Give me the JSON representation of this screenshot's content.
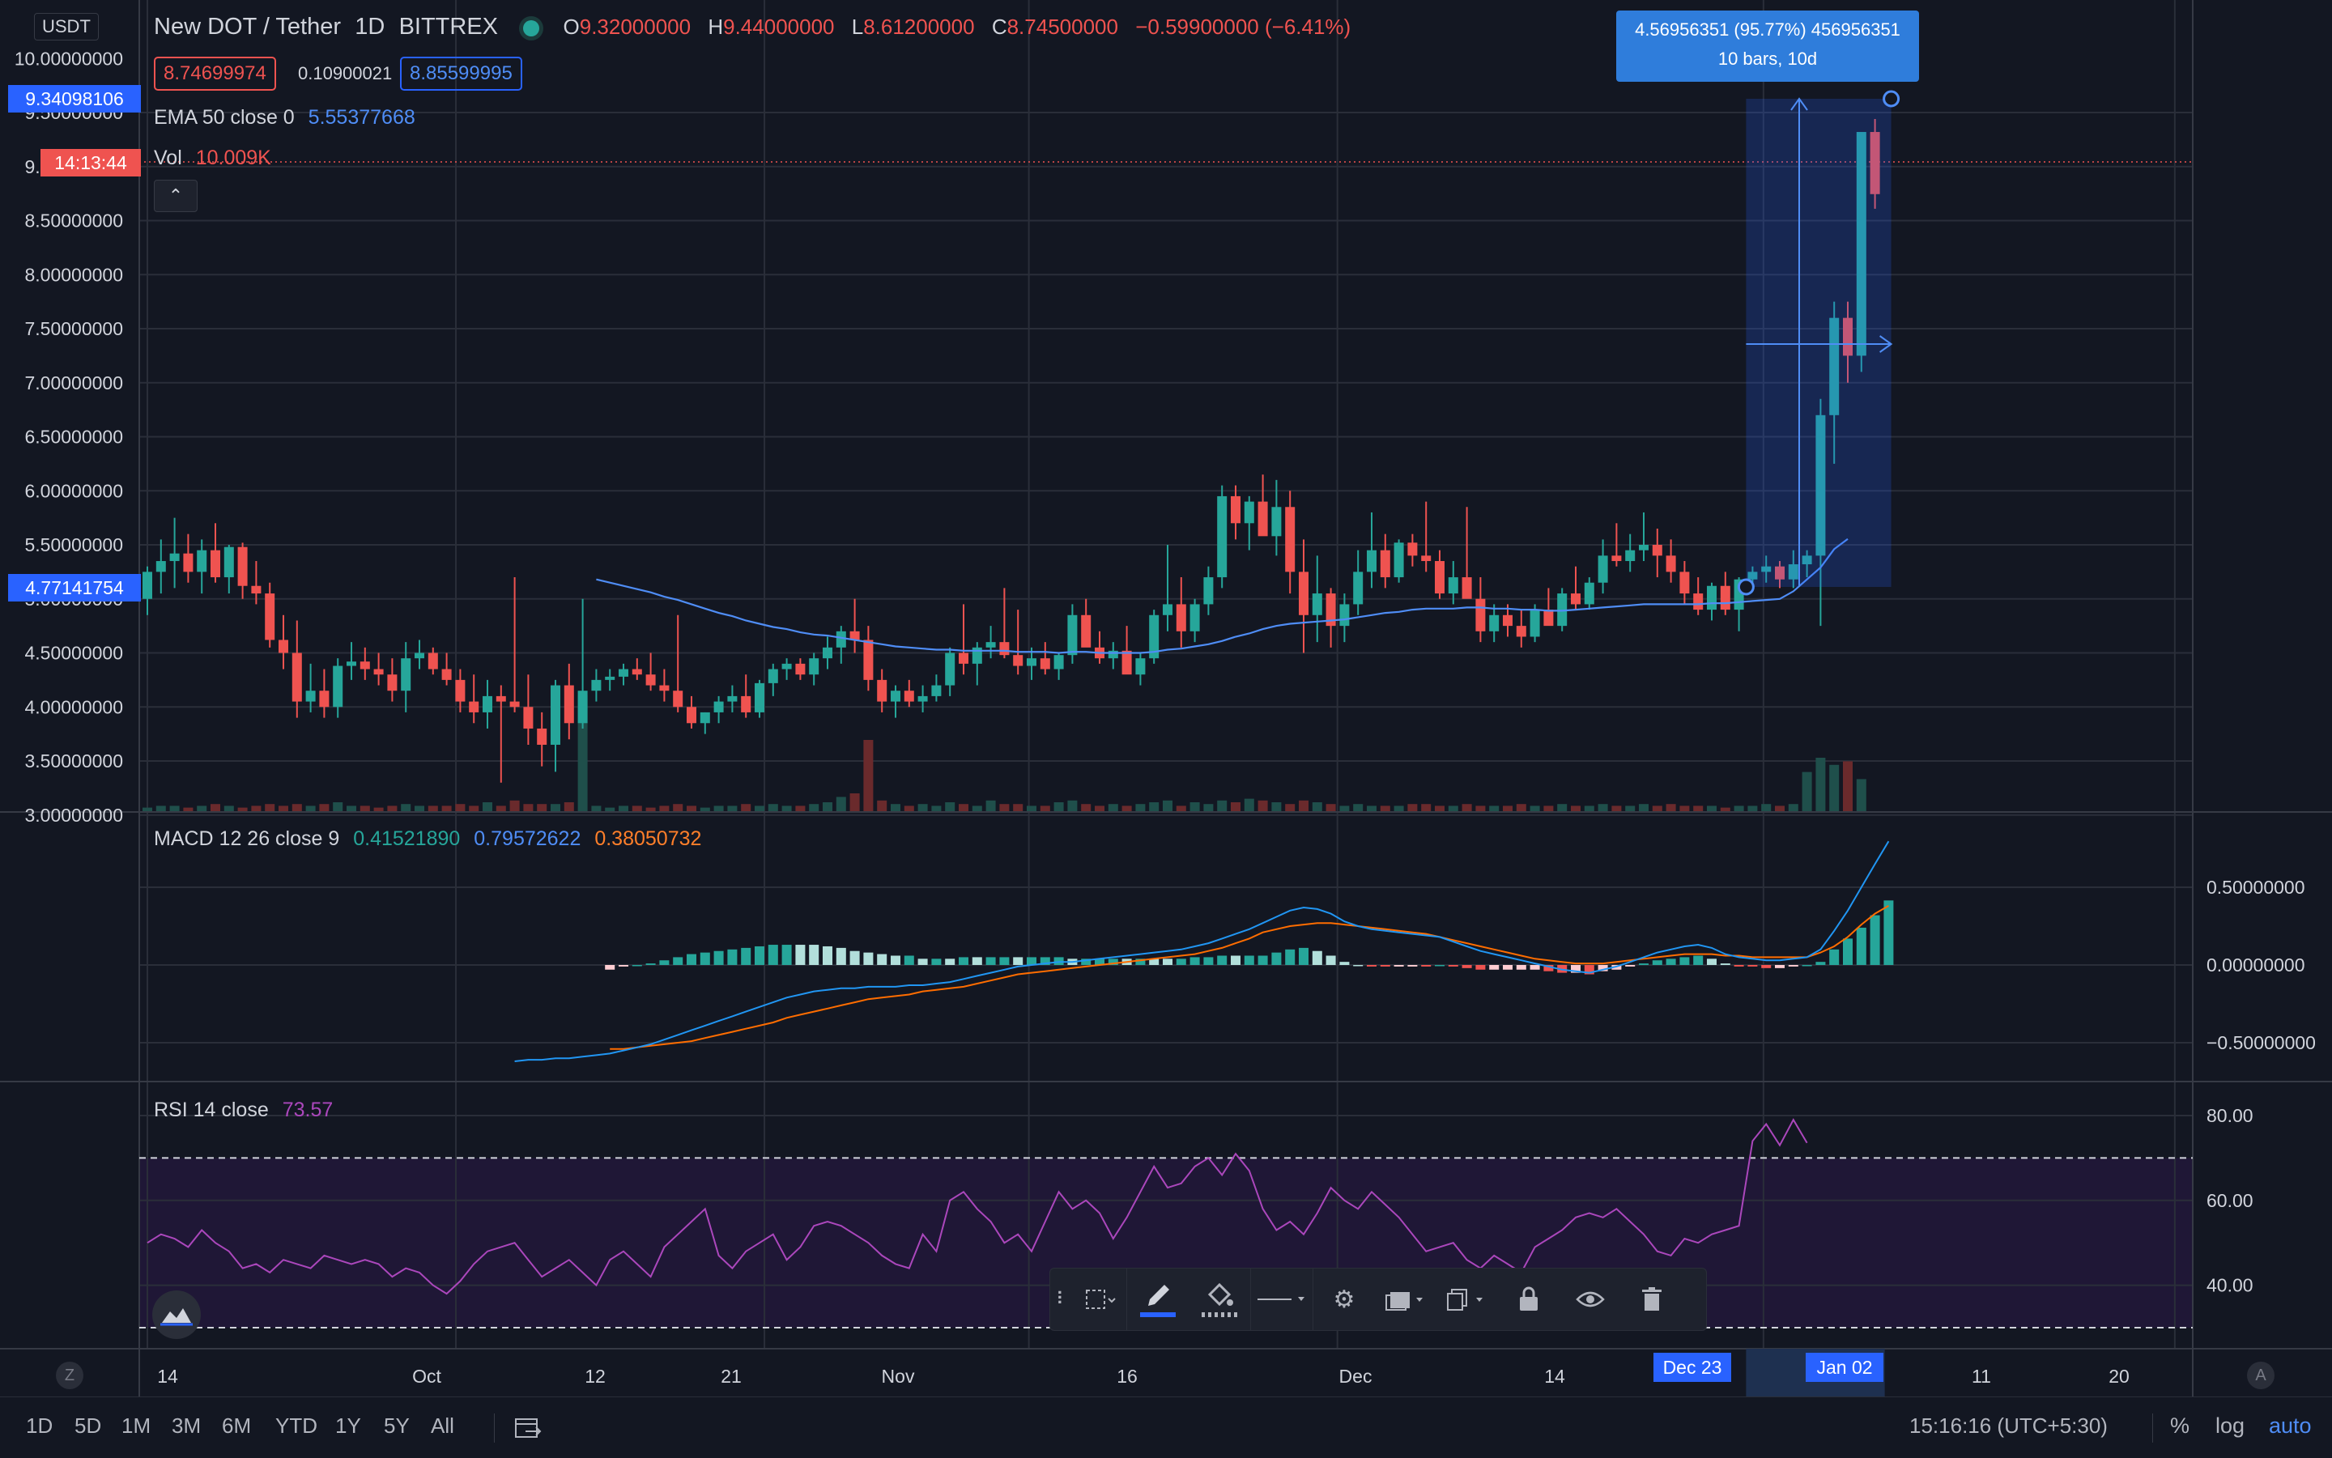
{
  "symbol": {
    "name": "New DOT / Tether",
    "interval": "1D",
    "exchange": "BITTREX",
    "open_label": "O",
    "open": "9.32000000",
    "high_label": "H",
    "high": "9.44000000",
    "low_label": "L",
    "low": "8.61200000",
    "close_label": "C",
    "close": "8.74500000",
    "change": "−0.59900000 (−6.41%)",
    "bid": "8.74699974",
    "spread": "0.10900021",
    "ask": "8.85599995",
    "currency_badge": "USDT"
  },
  "ema": {
    "label": "EMA 50 close 0",
    "value": "5.55377668"
  },
  "volume": {
    "label": "Vol",
    "value": "10.009K"
  },
  "macd": {
    "label": "MACD 12 26 close 9",
    "histogram": "0.41521890",
    "macd_value": "0.79572622",
    "signal_value": "0.38050732"
  },
  "rsi": {
    "label": "RSI 14 close",
    "value": "73.57"
  },
  "price_axis": {
    "ticks": [
      "10.00000000",
      "9.50000000",
      "9.00000000",
      "8.50000000",
      "8.00000000",
      "7.50000000",
      "7.00000000",
      "6.50000000",
      "6.00000000",
      "5.50000000",
      "5.00000000",
      "4.50000000",
      "4.00000000",
      "3.50000000",
      "3.00000000"
    ],
    "top_marker": "9.34098106",
    "countdown": "14:13:44",
    "bottom_marker": "4.77141754"
  },
  "macd_axis": {
    "ticks": [
      "0.50000000",
      "0.00000000",
      "−0.50000000"
    ]
  },
  "rsi_axis": {
    "ticks": [
      "80.00",
      "60.00",
      "40.00"
    ]
  },
  "time_axis": {
    "labels": [
      "14",
      "Oct",
      "12",
      "21",
      "Nov",
      "16",
      "Dec",
      "14",
      "11",
      "20"
    ],
    "range_start": "Dec 23",
    "range_end": "Jan 02"
  },
  "measure": {
    "line1": "4.56956351 (95.77%) 456956351",
    "line2": "10 bars, 10d"
  },
  "bottom_bar": {
    "ranges": [
      "1D",
      "5D",
      "1M",
      "3M",
      "6M",
      "YTD",
      "1Y",
      "5Y",
      "All"
    ],
    "clock": "15:16:16 (UTC+5:30)",
    "percent": "%",
    "log": "log",
    "auto": "auto"
  },
  "colors": {
    "up": "#26a69a",
    "down": "#ef5350",
    "ema": "#2962ff",
    "macd": "#2196f3",
    "signal": "#ff6d00",
    "rsi": "#9c27b0",
    "accent": "#2962ff"
  },
  "chart_data": {
    "type": "candlestick",
    "title": "New DOT / Tether",
    "interval": "1D",
    "ylim": [
      2.75,
      10.1
    ],
    "ohlc": [
      [
        5.0,
        5.3,
        4.85,
        5.25
      ],
      [
        5.25,
        5.55,
        5.05,
        5.35
      ],
      [
        5.35,
        5.75,
        5.1,
        5.42
      ],
      [
        5.42,
        5.6,
        5.15,
        5.25
      ],
      [
        5.25,
        5.55,
        5.05,
        5.45
      ],
      [
        5.45,
        5.7,
        5.15,
        5.2
      ],
      [
        5.2,
        5.5,
        5.05,
        5.48
      ],
      [
        5.48,
        5.52,
        5.0,
        5.12
      ],
      [
        5.12,
        5.35,
        4.95,
        5.05
      ],
      [
        5.05,
        5.15,
        4.55,
        4.62
      ],
      [
        4.62,
        4.85,
        4.35,
        4.5
      ],
      [
        4.5,
        4.8,
        3.9,
        4.05
      ],
      [
        4.05,
        4.4,
        3.95,
        4.15
      ],
      [
        4.15,
        4.35,
        3.9,
        4.0
      ],
      [
        4.0,
        4.45,
        3.9,
        4.38
      ],
      [
        4.38,
        4.6,
        4.25,
        4.42
      ],
      [
        4.42,
        4.55,
        4.25,
        4.35
      ],
      [
        4.35,
        4.5,
        4.2,
        4.3
      ],
      [
        4.3,
        4.45,
        4.05,
        4.15
      ],
      [
        4.15,
        4.6,
        3.95,
        4.45
      ],
      [
        4.45,
        4.62,
        4.35,
        4.5
      ],
      [
        4.5,
        4.55,
        4.3,
        4.35
      ],
      [
        4.35,
        4.5,
        4.2,
        4.25
      ],
      [
        4.25,
        4.35,
        3.95,
        4.05
      ],
      [
        4.05,
        4.3,
        3.85,
        3.95
      ],
      [
        3.95,
        4.25,
        3.8,
        4.1
      ],
      [
        4.1,
        4.2,
        3.3,
        4.05
      ],
      [
        4.05,
        5.2,
        3.95,
        4.0
      ],
      [
        4.0,
        4.3,
        3.65,
        3.8
      ],
      [
        3.8,
        3.95,
        3.45,
        3.65
      ],
      [
        3.65,
        4.25,
        3.4,
        4.2
      ],
      [
        4.2,
        4.4,
        3.7,
        3.85
      ],
      [
        3.85,
        5.0,
        3.8,
        4.15
      ],
      [
        4.15,
        4.35,
        4.05,
        4.25
      ],
      [
        4.25,
        4.35,
        4.15,
        4.28
      ],
      [
        4.28,
        4.4,
        4.2,
        4.35
      ],
      [
        4.35,
        4.45,
        4.25,
        4.3
      ],
      [
        4.3,
        4.5,
        4.15,
        4.2
      ],
      [
        4.2,
        4.35,
        4.05,
        4.15
      ],
      [
        4.15,
        4.85,
        3.95,
        4.0
      ],
      [
        4.0,
        4.1,
        3.8,
        3.85
      ],
      [
        3.85,
        3.95,
        3.75,
        3.95
      ],
      [
        3.95,
        4.1,
        3.85,
        4.05
      ],
      [
        4.05,
        4.2,
        3.95,
        4.1
      ],
      [
        4.1,
        4.3,
        3.9,
        3.95
      ],
      [
        3.95,
        4.25,
        3.9,
        4.22
      ],
      [
        4.22,
        4.4,
        4.1,
        4.35
      ],
      [
        4.35,
        4.45,
        4.25,
        4.4
      ],
      [
        4.4,
        4.45,
        4.25,
        4.3
      ],
      [
        4.3,
        4.5,
        4.2,
        4.45
      ],
      [
        4.45,
        4.65,
        4.35,
        4.55
      ],
      [
        4.55,
        4.75,
        4.4,
        4.7
      ],
      [
        4.7,
        5.0,
        4.5,
        4.62
      ],
      [
        4.62,
        4.75,
        4.15,
        4.25
      ],
      [
        4.25,
        4.35,
        3.95,
        4.05
      ],
      [
        4.05,
        4.2,
        3.9,
        4.15
      ],
      [
        4.15,
        4.25,
        4.0,
        4.05
      ],
      [
        4.05,
        4.2,
        3.95,
        4.1
      ],
      [
        4.1,
        4.3,
        4.05,
        4.2
      ],
      [
        4.2,
        4.55,
        4.1,
        4.5
      ],
      [
        4.5,
        4.95,
        4.3,
        4.4
      ],
      [
        4.4,
        4.6,
        4.2,
        4.55
      ],
      [
        4.55,
        4.75,
        4.45,
        4.6
      ],
      [
        4.6,
        5.1,
        4.45,
        4.48
      ],
      [
        4.48,
        4.9,
        4.3,
        4.38
      ],
      [
        4.38,
        4.55,
        4.25,
        4.45
      ],
      [
        4.45,
        4.6,
        4.3,
        4.35
      ],
      [
        4.35,
        4.5,
        4.25,
        4.48
      ],
      [
        4.48,
        4.95,
        4.4,
        4.85
      ],
      [
        4.85,
        5.0,
        4.7,
        4.55
      ],
      [
        4.55,
        4.7,
        4.4,
        4.45
      ],
      [
        4.45,
        4.6,
        4.35,
        4.52
      ],
      [
        4.52,
        4.75,
        4.4,
        4.3
      ],
      [
        4.3,
        4.5,
        4.2,
        4.45
      ],
      [
        4.45,
        4.9,
        4.4,
        4.85
      ],
      [
        4.85,
        5.5,
        4.7,
        4.95
      ],
      [
        4.95,
        5.2,
        4.55,
        4.7
      ],
      [
        4.7,
        5.0,
        4.6,
        4.95
      ],
      [
        4.95,
        5.3,
        4.85,
        5.2
      ],
      [
        5.2,
        6.05,
        5.1,
        5.95
      ],
      [
        5.95,
        6.05,
        5.55,
        5.7
      ],
      [
        5.7,
        5.95,
        5.45,
        5.9
      ],
      [
        5.9,
        6.15,
        5.85,
        5.58
      ],
      [
        5.58,
        6.1,
        5.4,
        5.85
      ],
      [
        5.85,
        6.0,
        5.05,
        5.25
      ],
      [
        5.25,
        5.55,
        4.5,
        4.85
      ],
      [
        4.85,
        5.4,
        4.6,
        5.05
      ],
      [
        5.05,
        5.1,
        4.55,
        4.75
      ],
      [
        4.75,
        5.05,
        4.6,
        4.95
      ],
      [
        4.95,
        5.45,
        4.85,
        5.25
      ],
      [
        5.25,
        5.8,
        5.1,
        5.45
      ],
      [
        5.45,
        5.6,
        5.1,
        5.2
      ],
      [
        5.2,
        5.55,
        5.15,
        5.52
      ],
      [
        5.52,
        5.6,
        5.3,
        5.4
      ],
      [
        5.4,
        5.9,
        5.25,
        5.35
      ],
      [
        5.35,
        5.45,
        5.0,
        5.05
      ],
      [
        5.05,
        5.35,
        4.95,
        5.2
      ],
      [
        5.2,
        5.85,
        5.1,
        5.0
      ],
      [
        5.0,
        5.2,
        4.6,
        4.7
      ],
      [
        4.7,
        4.95,
        4.6,
        4.85
      ],
      [
        4.85,
        4.95,
        4.65,
        4.75
      ],
      [
        4.75,
        4.9,
        4.55,
        4.65
      ],
      [
        4.65,
        4.95,
        4.6,
        4.9
      ],
      [
        4.9,
        5.1,
        4.8,
        4.75
      ],
      [
        4.75,
        5.1,
        4.7,
        5.05
      ],
      [
        5.05,
        5.3,
        4.9,
        4.95
      ],
      [
        4.95,
        5.2,
        4.9,
        5.15
      ],
      [
        5.15,
        5.55,
        5.05,
        5.4
      ],
      [
        5.4,
        5.7,
        5.3,
        5.35
      ],
      [
        5.35,
        5.6,
        5.25,
        5.45
      ],
      [
        5.45,
        5.8,
        5.35,
        5.5
      ],
      [
        5.5,
        5.65,
        5.2,
        5.4
      ],
      [
        5.4,
        5.55,
        5.15,
        5.25
      ],
      [
        5.25,
        5.35,
        4.95,
        5.05
      ],
      [
        5.05,
        5.2,
        4.85,
        4.9
      ],
      [
        4.9,
        5.15,
        4.8,
        5.12
      ],
      [
        5.12,
        5.25,
        4.85,
        4.9
      ],
      [
        4.9,
        5.2,
        4.7,
        5.18
      ],
      [
        5.18,
        5.3,
        5.1,
        5.25
      ],
      [
        5.25,
        5.4,
        5.15,
        5.3
      ],
      [
        5.3,
        5.35,
        5.1,
        5.18
      ],
      [
        5.18,
        5.45,
        5.1,
        5.32
      ],
      [
        5.32,
        5.45,
        5.2,
        5.4
      ],
      [
        5.4,
        6.85,
        4.75,
        6.7
      ],
      [
        6.7,
        7.75,
        6.25,
        7.6
      ],
      [
        7.6,
        7.75,
        7.0,
        7.25
      ],
      [
        7.25,
        9.3,
        7.1,
        9.32
      ],
      [
        9.32,
        9.44,
        8.61,
        8.745
      ]
    ],
    "volume": [
      0.2,
      0.3,
      0.3,
      0.2,
      0.3,
      0.4,
      0.3,
      0.2,
      0.3,
      0.4,
      0.3,
      0.4,
      0.3,
      0.4,
      0.5,
      0.3,
      0.3,
      0.2,
      0.3,
      0.4,
      0.3,
      0.3,
      0.3,
      0.4,
      0.3,
      0.5,
      0.3,
      0.6,
      0.4,
      0.4,
      0.4,
      0.5,
      6.5,
      0.3,
      0.2,
      0.3,
      0.3,
      0.2,
      0.3,
      0.4,
      0.3,
      0.2,
      0.3,
      0.3,
      0.4,
      0.3,
      0.4,
      0.3,
      0.3,
      0.4,
      0.5,
      0.8,
      1.0,
      4.0,
      0.6,
      0.4,
      0.3,
      0.4,
      0.3,
      0.5,
      0.4,
      0.3,
      0.6,
      0.4,
      0.4,
      0.3,
      0.3,
      0.5,
      0.6,
      0.4,
      0.3,
      0.4,
      0.3,
      0.4,
      0.5,
      0.6,
      0.3,
      0.5,
      0.4,
      0.6,
      0.5,
      0.7,
      0.6,
      0.5,
      0.4,
      0.6,
      0.5,
      0.4,
      0.3,
      0.4,
      0.3,
      0.3,
      0.3,
      0.4,
      0.4,
      0.3,
      0.3,
      0.4,
      0.3,
      0.3,
      0.3,
      0.4,
      0.3,
      0.3,
      0.4,
      0.3,
      0.3,
      0.4,
      0.3,
      0.3,
      0.4,
      0.3,
      0.4,
      0.3,
      0.3,
      0.3,
      0.2,
      0.3,
      0.3,
      0.4,
      0.3,
      0.4,
      2.2,
      3.0,
      2.6,
      2.8,
      1.8
    ],
    "ema50": [
      null,
      null,
      null,
      null,
      null,
      null,
      null,
      null,
      null,
      null,
      null,
      null,
      null,
      null,
      null,
      null,
      null,
      null,
      null,
      null,
      null,
      null,
      null,
      null,
      null,
      null,
      null,
      null,
      null,
      null,
      null,
      null,
      null,
      5.18,
      5.15,
      5.12,
      5.09,
      5.06,
      5.02,
      4.99,
      4.95,
      4.91,
      4.87,
      4.84,
      4.8,
      4.77,
      4.74,
      4.72,
      4.69,
      4.67,
      4.66,
      4.64,
      4.62,
      4.6,
      4.58,
      4.56,
      4.55,
      4.54,
      4.53,
      4.53,
      4.52,
      4.52,
      4.52,
      4.52,
      4.51,
      4.51,
      4.51,
      4.5,
      4.51,
      4.51,
      4.5,
      4.5,
      4.5,
      4.5,
      4.51,
      4.53,
      4.54,
      4.56,
      4.58,
      4.61,
      4.65,
      4.68,
      4.72,
      4.75,
      4.77,
      4.78,
      4.79,
      4.8,
      4.81,
      4.83,
      4.85,
      4.87,
      4.88,
      4.9,
      4.91,
      4.91,
      4.91,
      4.92,
      4.92,
      4.91,
      4.91,
      4.9,
      4.9,
      4.89,
      4.89,
      4.9,
      4.91,
      4.92,
      4.93,
      4.94,
      4.95,
      4.95,
      4.95,
      4.95,
      4.95,
      4.96,
      4.96,
      4.97,
      4.98,
      4.99,
      5.0,
      5.07,
      5.18,
      5.29,
      5.46,
      5.55377668
    ],
    "macd_line": [
      null,
      null,
      null,
      null,
      null,
      null,
      null,
      null,
      null,
      null,
      null,
      null,
      null,
      null,
      null,
      null,
      null,
      null,
      null,
      null,
      null,
      null,
      null,
      null,
      null,
      null,
      null,
      -0.62,
      -0.61,
      -0.61,
      -0.6,
      -0.6,
      -0.59,
      -0.58,
      -0.57,
      -0.55,
      -0.53,
      -0.51,
      -0.48,
      -0.45,
      -0.42,
      -0.39,
      -0.36,
      -0.33,
      -0.3,
      -0.27,
      -0.24,
      -0.21,
      -0.19,
      -0.17,
      -0.16,
      -0.15,
      -0.15,
      -0.14,
      -0.14,
      -0.14,
      -0.13,
      -0.13,
      -0.12,
      -0.11,
      -0.09,
      -0.07,
      -0.05,
      -0.03,
      -0.01,
      0.0,
      0.01,
      0.02,
      0.02,
      0.03,
      0.04,
      0.05,
      0.06,
      0.07,
      0.08,
      0.09,
      0.1,
      0.12,
      0.14,
      0.17,
      0.2,
      0.23,
      0.27,
      0.31,
      0.35,
      0.37,
      0.36,
      0.33,
      0.28,
      0.25,
      0.23,
      0.22,
      0.21,
      0.2,
      0.19,
      0.18,
      0.15,
      0.12,
      0.09,
      0.07,
      0.05,
      0.03,
      0.01,
      -0.01,
      -0.03,
      -0.04,
      -0.05,
      -0.03,
      -0.01,
      0.02,
      0.05,
      0.08,
      0.1,
      0.12,
      0.13,
      0.11,
      0.07,
      0.05,
      0.04,
      0.03,
      0.03,
      0.04,
      0.05,
      0.1,
      0.22,
      0.35,
      0.5,
      0.65,
      0.79572622
    ],
    "signal_line": [
      null,
      null,
      null,
      null,
      null,
      null,
      null,
      null,
      null,
      null,
      null,
      null,
      null,
      null,
      null,
      null,
      null,
      null,
      null,
      null,
      null,
      null,
      null,
      null,
      null,
      null,
      null,
      null,
      null,
      null,
      null,
      null,
      null,
      null,
      -0.54,
      -0.54,
      -0.53,
      -0.52,
      -0.51,
      -0.5,
      -0.49,
      -0.47,
      -0.45,
      -0.43,
      -0.41,
      -0.39,
      -0.37,
      -0.34,
      -0.32,
      -0.3,
      -0.28,
      -0.26,
      -0.24,
      -0.22,
      -0.21,
      -0.2,
      -0.19,
      -0.17,
      -0.16,
      -0.15,
      -0.14,
      -0.12,
      -0.1,
      -0.08,
      -0.06,
      -0.05,
      -0.04,
      -0.03,
      -0.02,
      -0.01,
      0.0,
      0.01,
      0.02,
      0.03,
      0.04,
      0.05,
      0.06,
      0.07,
      0.09,
      0.11,
      0.14,
      0.17,
      0.21,
      0.23,
      0.25,
      0.26,
      0.27,
      0.27,
      0.26,
      0.25,
      0.24,
      0.23,
      0.22,
      0.21,
      0.2,
      0.18,
      0.16,
      0.14,
      0.12,
      0.1,
      0.08,
      0.06,
      0.04,
      0.03,
      0.02,
      0.01,
      0.01,
      0.01,
      0.02,
      0.03,
      0.04,
      0.05,
      0.06,
      0.07,
      0.07,
      0.07,
      0.06,
      0.06,
      0.05,
      0.05,
      0.05,
      0.05,
      0.05,
      0.08,
      0.12,
      0.18,
      0.26,
      0.33,
      0.38050732
    ],
    "rsi_values": [
      50,
      52,
      51,
      49,
      53,
      50,
      48,
      44,
      45,
      43,
      46,
      45,
      44,
      47,
      46,
      45,
      46,
      45,
      42,
      44,
      43,
      40,
      38,
      41,
      45,
      48,
      49,
      50,
      46,
      42,
      44,
      46,
      43,
      40,
      46,
      48,
      45,
      42,
      49,
      52,
      55,
      58,
      47,
      44,
      48,
      50,
      52,
      46,
      49,
      54,
      55,
      54,
      52,
      50,
      47,
      45,
      44,
      52,
      48,
      60,
      62,
      58,
      55,
      50,
      52,
      48,
      55,
      62,
      58,
      60,
      57,
      51,
      56,
      62,
      68,
      63,
      64,
      68,
      70,
      66,
      71,
      67,
      58,
      53,
      55,
      52,
      57,
      63,
      60,
      58,
      62,
      59,
      56,
      52,
      48,
      49,
      50,
      46,
      44,
      47,
      45,
      43,
      49,
      51,
      53,
      56,
      57,
      56,
      58,
      55,
      52,
      48,
      47,
      51,
      50,
      52,
      53,
      54,
      74,
      78,
      73,
      79,
      73.57
    ],
    "rsi_bands": [
      70,
      30
    ]
  }
}
